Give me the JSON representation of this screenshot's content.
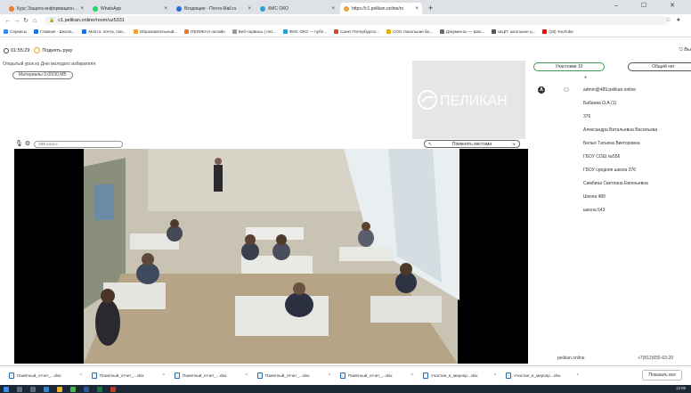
{
  "browser": {
    "tabs": [
      {
        "title": "Курс Защита информационных...",
        "color": "#e67c2e",
        "active": false
      },
      {
        "title": "WhatsApp",
        "color": "#25d366",
        "active": false
      },
      {
        "title": "Входящие - Почта Mail.ru",
        "color": "#1e6fd9",
        "active": false
      },
      {
        "title": "ФИС ОКО",
        "color": "#2a9fd6",
        "active": false
      },
      {
        "title": "https://c1.pelikan.online/ro",
        "color": "#e6a23c",
        "active": true
      }
    ],
    "new_tab": "+",
    "window_controls": "– ☐ ✕",
    "url": "c1.pelikan.online/room/uz5331",
    "bookmarks": [
      {
        "label": "Сервисы",
        "color": "#4285f4"
      },
      {
        "label": "Главная - Школа...",
        "color": "#1a73e8"
      },
      {
        "label": "Mail.ru: почта, пои...",
        "color": "#1e6fd9"
      },
      {
        "label": "Образовательный...",
        "color": "#f0a030"
      },
      {
        "label": "ПЕЛИКАН онлайн",
        "color": "#e67c2e"
      },
      {
        "label": "Веб-сервисы | Авт...",
        "color": "#999999"
      },
      {
        "label": "ФИС ОКО — публ...",
        "color": "#2a9fd6"
      },
      {
        "label": "Санкт-Петербургск...",
        "color": "#d04a2a"
      },
      {
        "label": "СОО Локальная ба...",
        "color": "#e0b000"
      },
      {
        "label": "Документы — Шко...",
        "color": "#6a6a6a"
      },
      {
        "label": "ШЦП: школьное ц...",
        "color": "#555555"
      },
      {
        "label": "(28) YouTube",
        "color": "#ff0000"
      }
    ]
  },
  "room": {
    "timer": "01:55:29",
    "raise_hand": "Поднять руку",
    "exit": "Вы",
    "lesson_title": "Открытый урок ко Дню молодого избирателя",
    "materials": "Материалы 0.00/30 МБ",
    "class_placeholder": "489 класс",
    "swap_label": "Поменять местами",
    "logo_text": "ПЕЛИКАН"
  },
  "sidebar": {
    "participants_tab": "Участники  10",
    "chat_tab": "Общий чат",
    "host_badge": "A",
    "participants": [
      "admin@489.pelikan.online",
      "Бабаева О.А (1)",
      "376",
      "Александра Витальевна Васильева",
      "Белых Татьяна Викторовна",
      "ГБОУ СОШ №556",
      "ГБОУ средняя школа 376",
      "Симбина Светлана Евгеньевна",
      "Школа 489",
      "школа 543"
    ],
    "footer_site": "pelikan.online",
    "footer_phone": "+7(812)655-63-20"
  },
  "downloads": {
    "items": [
      "Паевтный_отчет_...xlsx",
      "Паевтный_отчет_...xlsx",
      "Паевтный_отчет_...xlsx",
      "Паевтный_отчет_...xlsx",
      "Паевтный_отчет_...xlsx",
      "Участие_в_меропр...xlsx",
      "Участие_в_меропр...xlsx"
    ],
    "show_all": "Показать все"
  },
  "taskbar": {
    "time": "12:09"
  }
}
